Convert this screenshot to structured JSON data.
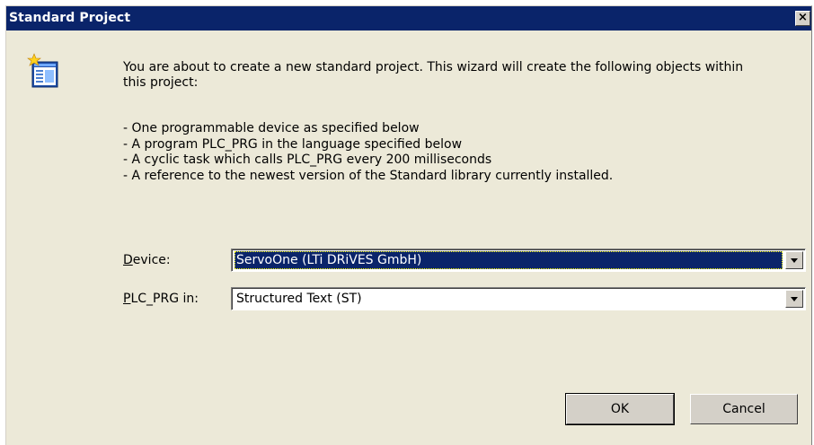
{
  "window": {
    "title": "Standard Project",
    "close_glyph": "×"
  },
  "icons": {
    "wizard": "new-project-wizard-icon",
    "close": "close-icon",
    "dropdown": "chevron-down-icon"
  },
  "intro": {
    "text": "You are about to create a new standard project. This wizard will create the following objects within this project:"
  },
  "bullets": [
    "- One programmable device as specified below",
    "- A program PLC_PRG in the language specified below",
    "- A cyclic task which calls PLC_PRG every 200 milliseconds",
    "- A reference to the newest version of the Standard library currently installed."
  ],
  "fields": {
    "device": {
      "label_accel": "D",
      "label_rest": "evice:",
      "value": "ServoOne (LTi DRiVES GmbH)"
    },
    "plc_prg": {
      "label_accel": "P",
      "label_rest": "LC_PRG in:",
      "value": "Structured Text (ST)"
    }
  },
  "buttons": {
    "ok": "OK",
    "cancel": "Cancel"
  },
  "colors": {
    "titlebar": "#0a246a",
    "dialog_bg": "#ece9d8",
    "selection": "#0a246a"
  }
}
